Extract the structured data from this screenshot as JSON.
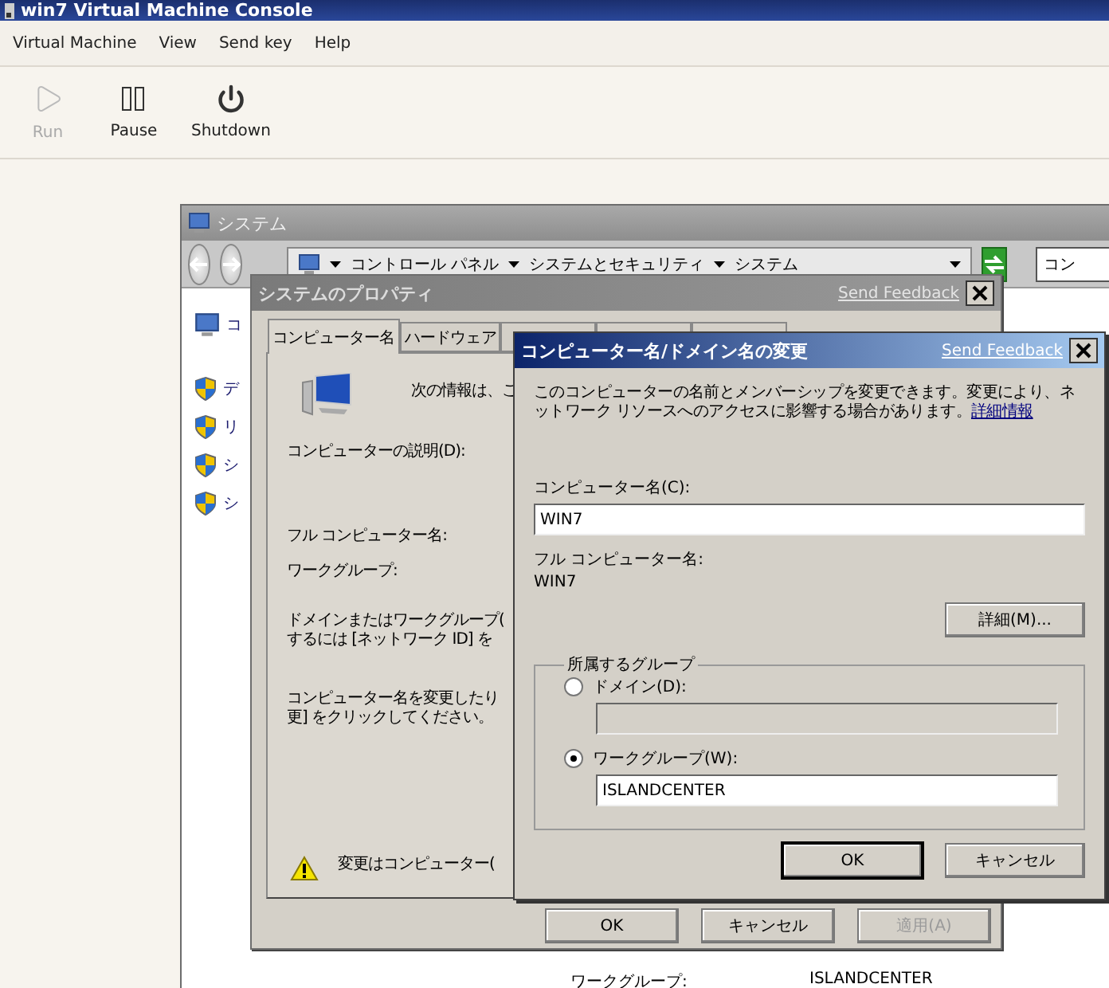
{
  "console": {
    "title": "win7 Virtual Machine Console",
    "menu": [
      "Virtual Machine",
      "View",
      "Send key",
      "Help"
    ],
    "toolbar": [
      {
        "label": "Run",
        "kind": "play",
        "disabled": true
      },
      {
        "label": "Pause",
        "kind": "pause",
        "disabled": false
      },
      {
        "label": "Shutdown",
        "kind": "power",
        "disabled": false
      }
    ]
  },
  "system_window": {
    "title": "システム",
    "breadcrumb": [
      "コントロール パネル",
      "システムとセキュリティ",
      "システム"
    ],
    "search": "コン",
    "sidebar": [
      {
        "kind": "monitor",
        "label": "コ"
      },
      {
        "kind": "shield",
        "label": "デ"
      },
      {
        "kind": "shield",
        "label": "リ"
      },
      {
        "kind": "shield",
        "label": "シ"
      },
      {
        "kind": "shield",
        "label": "シ"
      }
    ],
    "rows": [
      {
        "label": "ワークグループ:",
        "value": "ISLANDCENTER"
      }
    ]
  },
  "properties_dialog": {
    "title": "システムのプロパティ",
    "feedback": "Send Feedback",
    "tabs": [
      {
        "label": "コンピューター名",
        "selected": true
      },
      {
        "label": "ハードウェア",
        "selected": false
      },
      {
        "selected": false
      },
      {
        "selected": false
      },
      {
        "selected": false
      }
    ],
    "intro": "次の情報は、こ",
    "description_label": "コンピューターの説明(D):",
    "full_name_label": "フル コンピューター名:",
    "workgroup_label": "ワークグループ:",
    "paragraphs": [
      [
        "ドメインまたはワークグループ(",
        "するには [ネットワーク ID] を"
      ],
      [
        "コンピューター名を変更したり",
        "更] をクリックしてください。"
      ]
    ],
    "warning": "変更はコンピューター(",
    "buttons": [
      {
        "label": "OK",
        "disabled": false
      },
      {
        "label": "キャンセル",
        "disabled": false
      },
      {
        "label": "適用(A)",
        "disabled": true
      }
    ]
  },
  "change_dialog": {
    "title": "コンピューター名/ドメイン名の変更",
    "feedback": "Send Feedback",
    "message": "このコンピューターの名前とメンバーシップを変更できます。変更により、ネットワーク リソースへのアクセスに影響する場合があります。",
    "link": "詳細情報",
    "name_label": "コンピューター名(C):",
    "name_value": "WIN7",
    "full_name_label": "フル コンピューター名:",
    "full_name": "WIN7",
    "more_button": "詳細(M)...",
    "group_title": "所属するグループ",
    "options": [
      {
        "label": "ドメイン(D):",
        "selected": false
      },
      {
        "label": "ワークグループ(W):",
        "selected": true,
        "value": "ISLANDCENTER"
      }
    ],
    "buttons": [
      {
        "label": "OK",
        "default": true
      },
      {
        "label": "キャンセル",
        "default": false
      }
    ]
  }
}
